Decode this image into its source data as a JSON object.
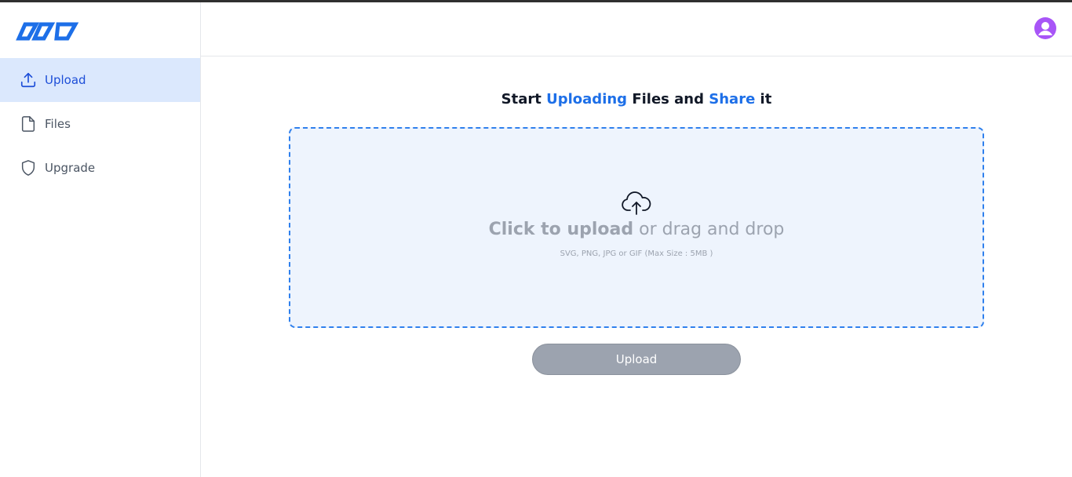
{
  "brand": {
    "accent": "#2f80ed",
    "avatar_color": "#a855f7"
  },
  "sidebar": {
    "items": [
      {
        "label": "Upload",
        "icon": "upload-icon",
        "active": true
      },
      {
        "label": "Files",
        "icon": "file-icon",
        "active": false
      },
      {
        "label": "Upgrade",
        "icon": "shield-icon",
        "active": false
      }
    ]
  },
  "main": {
    "headline": {
      "part1": "Start ",
      "highlight1": "Uploading",
      "part2": " Files and ",
      "highlight2": "Share",
      "part3": " it"
    },
    "dropzone": {
      "icon": "cloud-upload-icon",
      "cta_strong": "Click to upload",
      "cta_rest": " or drag and drop",
      "hint": "SVG, PNG, JPG or GIF (Max Size : 5MB )"
    },
    "upload_button": "Upload"
  }
}
